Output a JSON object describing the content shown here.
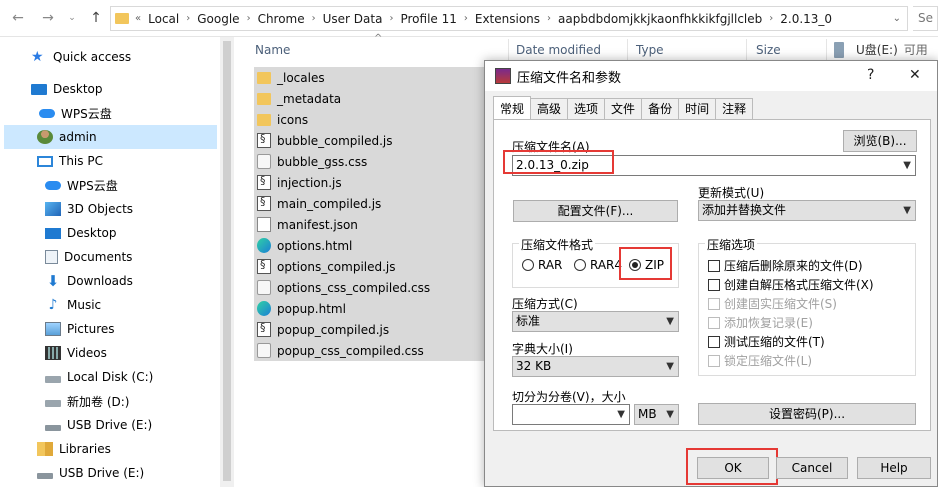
{
  "address": {
    "breadcrumbs": [
      "Local",
      "Google",
      "Chrome",
      "User Data",
      "Profile 11",
      "Extensions",
      "aapbdbdomjkkjkaonfhkkikfgjllcleb",
      "2.0.13_0"
    ],
    "refresh_label": "Se"
  },
  "sidebar": {
    "items": [
      {
        "label": "Quick access",
        "icon": "star-icon"
      },
      {
        "label": "Desktop",
        "icon": "desktop-icon"
      },
      {
        "label": "WPS云盘",
        "icon": "cloud-icon"
      },
      {
        "label": "admin",
        "icon": "user-icon"
      },
      {
        "label": "This PC",
        "icon": "computer-icon"
      },
      {
        "label": "WPS云盘",
        "icon": "cloud-icon"
      },
      {
        "label": "3D Objects",
        "icon": "cube-icon"
      },
      {
        "label": "Desktop",
        "icon": "desktop-icon"
      },
      {
        "label": "Documents",
        "icon": "document-icon"
      },
      {
        "label": "Downloads",
        "icon": "download-icon"
      },
      {
        "label": "Music",
        "icon": "music-icon"
      },
      {
        "label": "Pictures",
        "icon": "picture-icon"
      },
      {
        "label": "Videos",
        "icon": "video-icon"
      },
      {
        "label": "Local Disk (C:)",
        "icon": "drive-icon"
      },
      {
        "label": "新加卷 (D:)",
        "icon": "drive-icon"
      },
      {
        "label": "USB Drive (E:)",
        "icon": "usb-drive-icon"
      },
      {
        "label": "Libraries",
        "icon": "library-icon"
      },
      {
        "label": "USB Drive (E:)",
        "icon": "usb-drive-icon"
      }
    ]
  },
  "filelist": {
    "columns": {
      "name": "Name",
      "date": "Date modified",
      "type": "Type",
      "size": "Size"
    },
    "usb_label": "U盘(E:)",
    "usb_usage": "可用",
    "files": [
      {
        "name": "_locales",
        "icon": "folder-icon"
      },
      {
        "name": "_metadata",
        "icon": "folder-icon"
      },
      {
        "name": "icons",
        "icon": "folder-icon"
      },
      {
        "name": "bubble_compiled.js",
        "icon": "js-file-icon"
      },
      {
        "name": "bubble_gss.css",
        "icon": "css-file-icon"
      },
      {
        "name": "injection.js",
        "icon": "js-file-icon"
      },
      {
        "name": "main_compiled.js",
        "icon": "js-file-icon"
      },
      {
        "name": "manifest.json",
        "icon": "json-file-icon"
      },
      {
        "name": "options.html",
        "icon": "edge-html-icon"
      },
      {
        "name": "options_compiled.js",
        "icon": "js-file-icon"
      },
      {
        "name": "options_css_compiled.css",
        "icon": "css-file-icon"
      },
      {
        "name": "popup.html",
        "icon": "edge-html-icon"
      },
      {
        "name": "popup_compiled.js",
        "icon": "js-file-icon"
      },
      {
        "name": "popup_css_compiled.css",
        "icon": "css-file-icon"
      }
    ]
  },
  "dialog": {
    "title": "压缩文件名和参数",
    "help_btn": "?",
    "close_btn": "✕",
    "tabs": [
      "常规",
      "高级",
      "选项",
      "文件",
      "备份",
      "时间",
      "注释"
    ],
    "archive_name_label": "压缩文件名(A)",
    "browse_button": "浏览(B)...",
    "archive_name_value": "2.0.13_0.zip",
    "update_mode_label": "更新模式(U)",
    "update_mode_value": "添加并替换文件",
    "profiles_button": "配置文件(F)...",
    "format_group": "压缩文件格式",
    "formats": [
      "RAR",
      "RAR4",
      "ZIP"
    ],
    "selected_format": "ZIP",
    "options_group": "压缩选项",
    "options": [
      {
        "label": "压缩后删除原来的文件(D)",
        "enabled": true
      },
      {
        "label": "创建自解压格式压缩文件(X)",
        "enabled": true
      },
      {
        "label": "创建固实压缩文件(S)",
        "enabled": false
      },
      {
        "label": "添加恢复记录(E)",
        "enabled": false
      },
      {
        "label": "测试压缩的文件(T)",
        "enabled": true
      },
      {
        "label": "锁定压缩文件(L)",
        "enabled": false
      }
    ],
    "method_label": "压缩方式(C)",
    "method_value": "标准",
    "dict_label": "字典大小(I)",
    "dict_value": "32 KB",
    "split_label": "切分为分卷(V)，大小",
    "split_value": "",
    "split_unit": "MB",
    "password_button": "设置密码(P)...",
    "ok_button": "OK",
    "cancel_button": "Cancel",
    "help_button": "Help"
  },
  "colors": {
    "highlight": "#e53935",
    "selection": "#cce8ff",
    "folder": "#f2c65c"
  }
}
